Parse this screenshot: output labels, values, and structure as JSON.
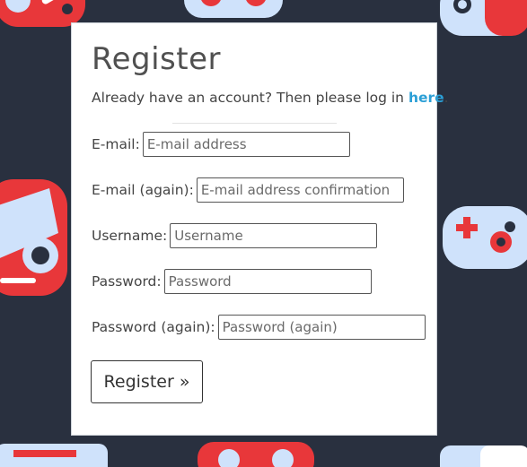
{
  "form": {
    "title": "Register",
    "intro_text": "Already have an account? Then please log in ",
    "intro_link": "here",
    "intro_end": ".",
    "fields": [
      {
        "label": "E-mail:",
        "placeholder": "E-mail address",
        "value": ""
      },
      {
        "label": "E-mail (again):",
        "placeholder": "E-mail address confirmation",
        "value": ""
      },
      {
        "label": "Username:",
        "placeholder": "Username",
        "value": ""
      },
      {
        "label": "Password:",
        "placeholder": "Password",
        "value": ""
      },
      {
        "label": "Password (again):",
        "placeholder": "Password (again)",
        "value": ""
      }
    ],
    "submit_label": "Register »"
  },
  "colors": {
    "background": "#29303f",
    "link": "#2b9fd6",
    "controller_red": "#e8373a",
    "controller_light": "#cfe2fb"
  },
  "background_icons": [
    "gamepad-icon"
  ]
}
